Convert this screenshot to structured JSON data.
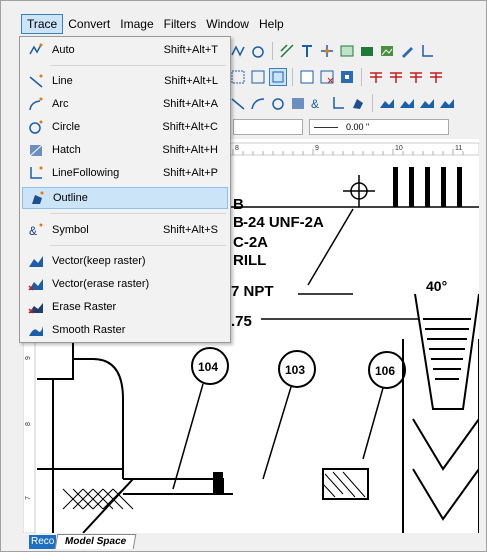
{
  "menubar": {
    "items": [
      "Trace",
      "Convert",
      "Image",
      "Filters",
      "Window",
      "Help"
    ]
  },
  "dropdown": {
    "items": [
      {
        "label": "Auto",
        "shortcut": "Shift+Alt+T",
        "icon": "auto-trace-icon"
      },
      {
        "label": "Line",
        "shortcut": "Shift+Alt+L",
        "icon": "line-icon"
      },
      {
        "label": "Arc",
        "shortcut": "Shift+Alt+A",
        "icon": "arc-icon"
      },
      {
        "label": "Circle",
        "shortcut": "Shift+Alt+C",
        "icon": "circle-icon"
      },
      {
        "label": "Hatch",
        "shortcut": "Shift+Alt+H",
        "icon": "hatch-icon"
      },
      {
        "label": "LineFollowing",
        "shortcut": "Shift+Alt+P",
        "icon": "line-following-icon"
      },
      {
        "label": "Outline",
        "shortcut": "",
        "icon": "outline-icon"
      },
      {
        "label": "Symbol",
        "shortcut": "Shift+Alt+S",
        "icon": "symbol-icon"
      },
      {
        "label": "Vector(keep raster)",
        "shortcut": "",
        "icon": "vector-keep-icon"
      },
      {
        "label": "Vector(erase raster)",
        "shortcut": "",
        "icon": "vector-erase-icon"
      },
      {
        "label": "Erase Raster",
        "shortcut": "",
        "icon": "erase-raster-icon"
      },
      {
        "label": "Smooth Raster",
        "shortcut": "",
        "icon": "smooth-raster-icon"
      }
    ]
  },
  "toolbar": {
    "value_field": "0.00 \""
  },
  "ruler": {
    "top_ticks": [
      "8",
      "9",
      "10",
      "11"
    ],
    "left_ticks": [
      "9",
      "8",
      "7"
    ]
  },
  "drawing": {
    "labels": [
      "104",
      "103",
      "106"
    ],
    "texts": [
      "-24 UNF-2A",
      "C-2A",
      "RILL",
      "7 NPT",
      ".75",
      "40°",
      "B",
      "B"
    ]
  },
  "tabs": {
    "record": "Reco",
    "model_space": "Model Space"
  },
  "colors": {
    "accent": "#1f6fc1",
    "highlight": "#cce4f7"
  }
}
